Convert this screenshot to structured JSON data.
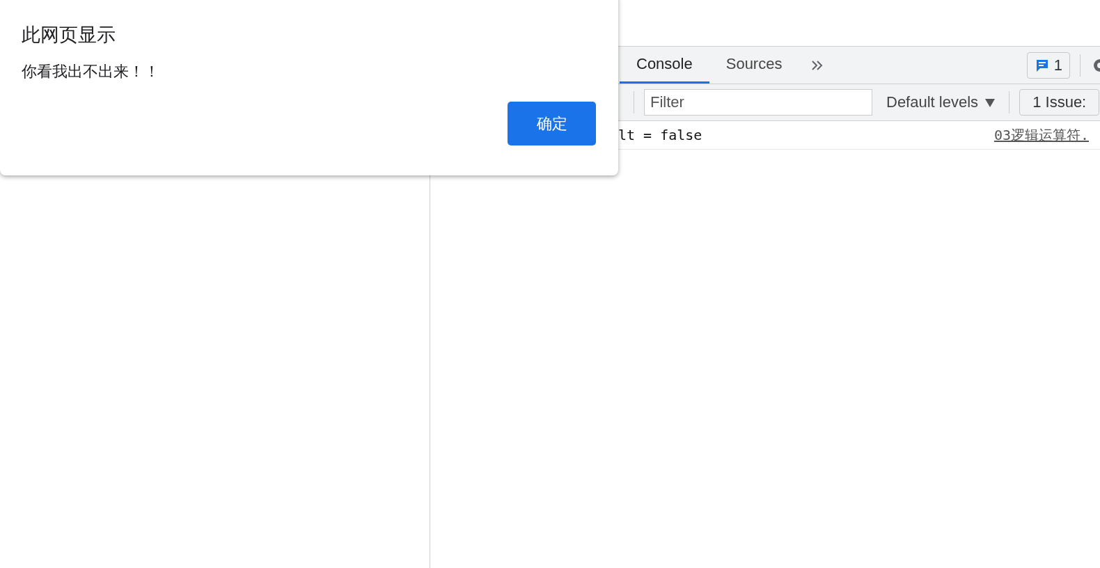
{
  "dialog": {
    "title": "此网页显示",
    "message": "你看我出不出来！！",
    "button": "确定"
  },
  "devtools": {
    "tabs": [
      {
        "label": "Console",
        "selected": true
      },
      {
        "label": "Sources",
        "selected": false
      }
    ],
    "messages_count": "1",
    "filter": {
      "placeholder": "Filter"
    },
    "levels": "Default levels",
    "issues_button": "1 Issue:",
    "console_rows": [
      {
        "text": "lt = false",
        "source": "03逻辑运算符."
      }
    ]
  }
}
